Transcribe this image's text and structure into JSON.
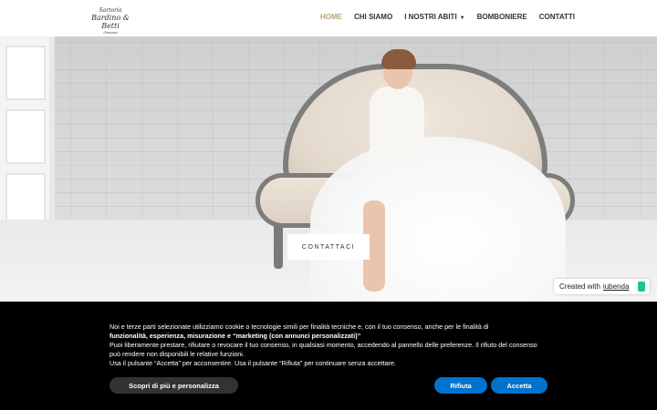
{
  "header": {
    "logo": {
      "line1": "Sartoria",
      "line2": "Bardino & Betti",
      "line3": "Genova"
    },
    "nav": [
      {
        "label": "HOME",
        "active": true
      },
      {
        "label": "CHI SIAMO",
        "active": false
      },
      {
        "label": "I NOSTRI ABITI",
        "active": false,
        "has_dropdown": true
      },
      {
        "label": "BOMBONIERE",
        "active": false
      },
      {
        "label": "CONTATTI",
        "active": false
      }
    ],
    "accent_color": "#b8a57c"
  },
  "hero": {
    "cta_label": "CONTATTACI"
  },
  "iubenda_badge": {
    "prefix": "Created with",
    "link": "iubenda"
  },
  "cookie_banner": {
    "text_intro": "Noi e terze parti selezionate utilizziamo cookie o tecnologie simili per finalità tecniche e, con il tuo consenso, anche per le finalità di",
    "text_bold": "funzionalità, esperienza, misurazione e “marketing (con annunci personalizzati)”",
    "text_line2": "Puoi liberamente prestare, rifiutare o revocare il tuo consenso, in qualsiasi momento, accedendo al pannello delle preferenze. Il rifiuto del consenso può rendere non disponibili le relative funzioni.",
    "text_line3": "Usa il pulsante “Accetta” per acconsentire. Usa il pulsante “Rifiuta” per continuare senza accettare.",
    "more_label": "Scopri di più e personalizza",
    "reject_label": "Rifiuta",
    "accept_label": "Accetta",
    "button_color": "#0073ce"
  }
}
